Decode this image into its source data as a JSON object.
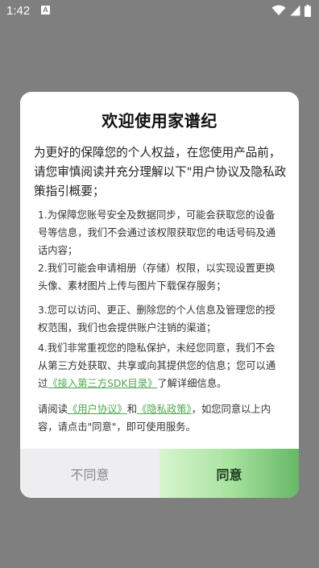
{
  "status_bar": {
    "time": "1:42",
    "notification_glyph": "A",
    "icons": [
      "wifi-icon",
      "signal-icon",
      "battery-icon"
    ]
  },
  "dialog": {
    "title": "欢迎使用家谱纪",
    "intro": "为更好的保障您的个人权益，在您使用产品前，请您审慎阅读并充分理解以下\"用户协议及隐私政策指引概要；",
    "items": [
      "1.为保障您账号安全及数据同步，可能会获取您的设备号等信息，我们不会通过该权限获取您的电话号码及通话内容；",
      "2.我们可能会申请相册（存储）权限，以实现设置更换头像、素材图片上传与图片下载保存服务；",
      "3.您可以访问、更正、删除您的个人信息及管理您的授权范围，我们也会提供账户注销的渠道；"
    ],
    "item4": {
      "text": "4.我们非常重视您的隐私保护，未经您同意，我们不会从第三方处获取、共享或向其提供您的信息；您可以通过",
      "link": "《接入第三方SDK目录》",
      "suffix": "了解详细信息。"
    },
    "notice": {
      "prefix": "请阅读",
      "link1": "《用户协议》",
      "and": "和",
      "link2": "《隐私政策》",
      "suffix": "，如您同意以上内容，请点击\"同意\"，即可使用服务。"
    },
    "buttons": {
      "disagree": "不同意",
      "agree": "同意"
    }
  },
  "colors": {
    "overlay": "#7f7f7f",
    "link": "#4ea84e",
    "agree_gradient_start": "#d8f5d0",
    "agree_gradient_end": "#66b866",
    "disagree_bg": "#eeeef0"
  }
}
